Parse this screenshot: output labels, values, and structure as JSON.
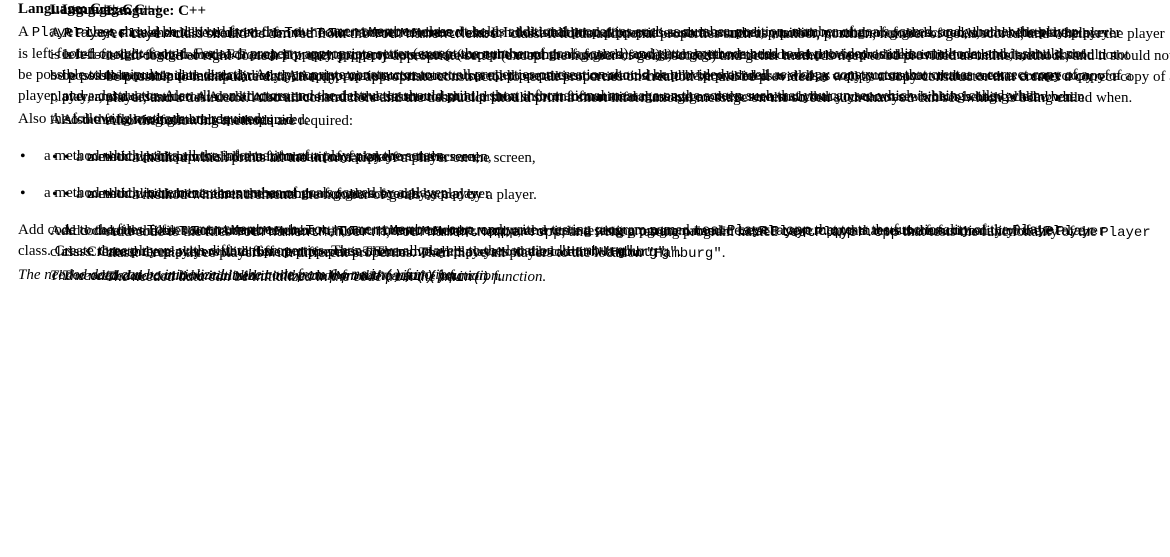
{
  "heading": {
    "label": "Language:",
    "value": "C++"
  },
  "para1": {
    "pre": "A ",
    "code1": "Player",
    "mid1": " class should be derived from the ",
    "code2": "TournamentMember",
    "post": " class. It holds additional properties such as number, position, number of goals scored, and whether the player is left-footed or right-footed. For each property appropriate setter (except the number of goals scored) and getter methods need to be provided as inline methods, and it should not be possible to manipulate data directly. An appropriate constructor to set all properties on creation should be provided as well as a copy constructor that creates a correct copy of a player, and a destructor. Also all constructors and the destructor should print a short informational message on the screen such that you can see which is being called when."
  },
  "para2": "Also the following methods are required:",
  "bullets": [
    "a method which prints all the information of a player on the screen,",
    "a method which increments the number of goals scored by a player."
  ],
  "para3": {
    "t0": "Add code to the files ",
    "c1": "TournamentMember.h",
    "t1": ", ",
    "c2": "TournamentMember.cpp",
    "t2": ", and write a testing program named ",
    "c3": "testPlayer.cpp",
    "t3": " that tests the functionality of the ",
    "c4": "Player",
    "t4": " class. Create three players with different properties. Then move all players to the location ",
    "c5": "\"Hamburg\"",
    "t5": "."
  },
  "para4": {
    "pre": "The needed data can be initialized in the code from the ",
    "code": "main()",
    "post": " function."
  }
}
